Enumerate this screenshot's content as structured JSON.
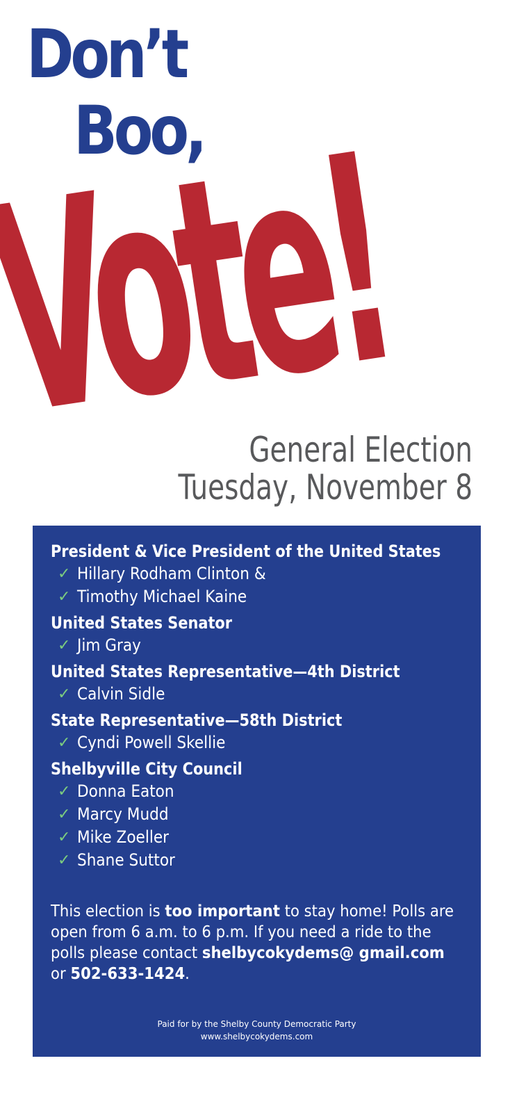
{
  "headline": {
    "line1": "Don’t",
    "line2": "Boo,",
    "big": "Vote!"
  },
  "event": {
    "title": "General Election",
    "date": "Tuesday, November 8"
  },
  "offices": [
    {
      "title": "President & Vice President of the United States",
      "candidates": [
        "Hillary Rodham Clinton &",
        "Timothy Michael Kaine"
      ]
    },
    {
      "title": "United States Senator",
      "candidates": [
        "Jim Gray"
      ]
    },
    {
      "title": "United States Representative—4th District",
      "candidates": [
        "Calvin Sidle"
      ]
    },
    {
      "title": "State Representative—58th District",
      "candidates": [
        "Cyndi Powell Skellie"
      ]
    },
    {
      "title": "Shelbyville City Council",
      "candidates": [
        "Donna Eaton",
        "Marcy Mudd",
        "Mike Zoeller",
        "Shane Suttor"
      ]
    }
  ],
  "note": {
    "p1": "This election is ",
    "b1": "too important",
    "p2": " to stay home! Polls are open from 6 a.m. to 6 p.m. If you need a ride to the polls please contact ",
    "b2": "shelbycokydems@ gmail.com",
    "p3": " or ",
    "b3": "502-633-1424",
    "p4": "."
  },
  "footer": {
    "paid_for": "Paid for by the Shelby County Democratic Party",
    "website": "www.shelbycokydems.com"
  },
  "colors": {
    "blue": "#243f8f",
    "red": "#b82832",
    "gray": "#58595b",
    "check": "#7ccc7f"
  },
  "icons": {
    "candidate_marker": "check-icon"
  }
}
